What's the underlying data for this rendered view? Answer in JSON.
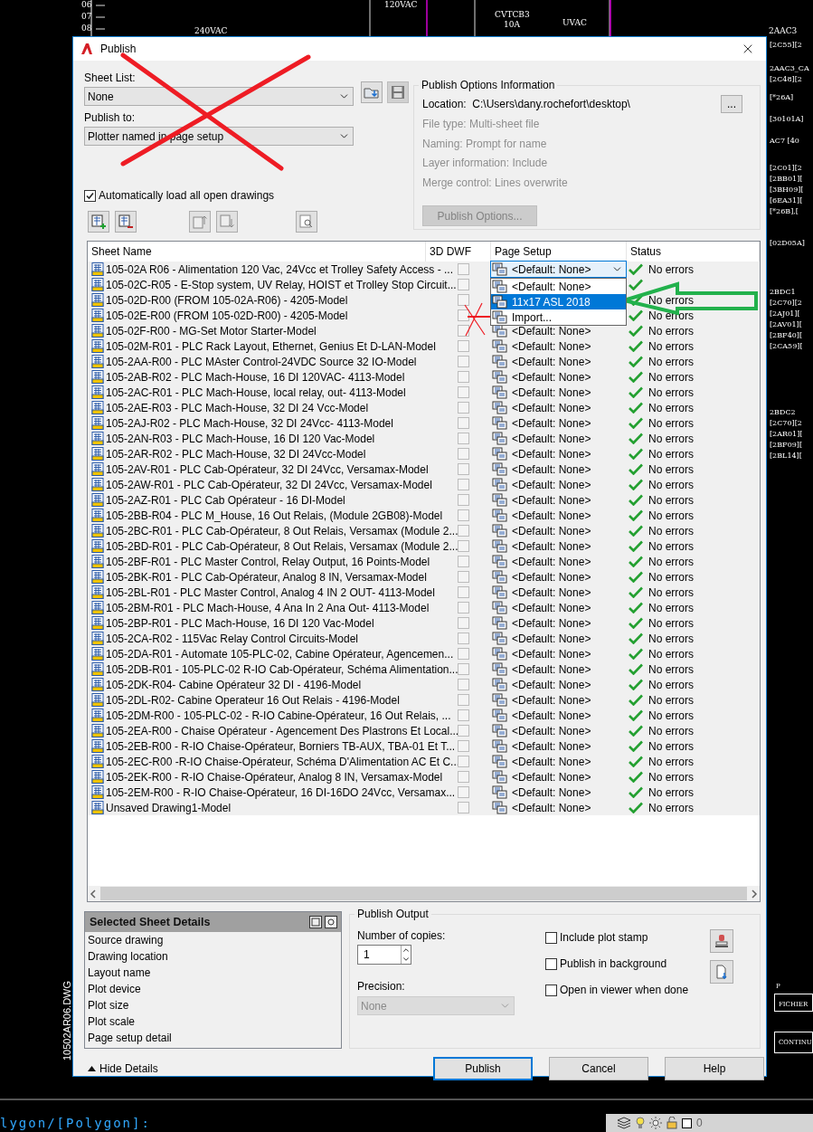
{
  "window": {
    "title": "Publish"
  },
  "sheet_list": {
    "label": "Sheet List:",
    "value": "None"
  },
  "publish_to": {
    "label": "Publish to:",
    "value": "Plotter named in page setup"
  },
  "auto_load": {
    "label": "Automatically load all open drawings",
    "checked": true
  },
  "publish_options_info": {
    "title": "Publish Options Information",
    "location": "Location:  C:\\Users\\dany.rochefort\\desktop\\",
    "browse_button": "...",
    "details": [
      "File type: Multi-sheet file",
      "Naming: Prompt for name",
      "Layer information: Include",
      "Merge control: Lines overwrite"
    ],
    "options_button": {
      "label": "Publish Options...",
      "disabled": true
    }
  },
  "table": {
    "columns": [
      "Sheet Name",
      "3D DWF",
      "Page Setup",
      "Status"
    ],
    "rows": [
      {
        "name": "105-02A R06 - Alimentation 120 Vac, 24Vcc et Trolley Safety Access - ...",
        "dwf_3d": false,
        "page_setup": "<Default: None>",
        "page_setup_options": [
          {
            "label": "<Default: None>",
            "selected": false
          },
          {
            "label": "11x17 ASL 2018",
            "selected": true
          },
          {
            "label": "Import...",
            "selected": false
          }
        ],
        "status": "No errors"
      },
      {
        "name": "105-02C-R05 - E-Stop system, UV Relay, HOIST et Trolley Stop Circuit...",
        "dwf_3d": false
      },
      {
        "name": "105-02D-R00 (FROM 105-02A-R06) - 4205-Model",
        "dwf_3d": false,
        "status": "No errors"
      },
      {
        "name": "105-02E-R00 (FROM 105-02D-R00) - 4205-Model",
        "dwf_3d": false,
        "status": "No errors"
      },
      {
        "name": "105-02F-R00 - MG-Set Motor Starter-Model",
        "dwf_3d": false,
        "page_setup": "<Default: None>",
        "status": "No errors"
      },
      {
        "name": "105-02M-R01 - PLC Rack Layout, Ethernet, Genius Et D-LAN-Model",
        "dwf_3d": false,
        "page_setup": "<Default: None>",
        "status": "No errors"
      },
      {
        "name": "105-2AA-R00 - PLC MAster Control-24VDC Source 32 IO-Model",
        "dwf_3d": false,
        "page_setup": "<Default: None>",
        "status": "No errors"
      },
      {
        "name": "105-2AB-R02 - PLC Mach-House, 16 DI 120VAC- 4113-Model",
        "dwf_3d": false,
        "page_setup": "<Default: None>",
        "status": "No errors"
      },
      {
        "name": "105-2AC-R01 - PLC Mach-House, local relay, out- 4113-Model",
        "dwf_3d": false,
        "page_setup": "<Default: None>",
        "status": "No errors"
      },
      {
        "name": "105-2AE-R03 - PLC Mach-House, 32 DI 24 Vcc-Model",
        "dwf_3d": false,
        "page_setup": "<Default: None>",
        "status": "No errors"
      },
      {
        "name": "105-2AJ-R02 - PLC Mach-House, 32 DI 24Vcc- 4113-Model",
        "dwf_3d": false,
        "page_setup": "<Default: None>",
        "status": "No errors"
      },
      {
        "name": "105-2AN-R03 - PLC Mach-House, 16 DI 120 Vac-Model",
        "dwf_3d": false,
        "page_setup": "<Default: None>",
        "status": "No errors"
      },
      {
        "name": "105-2AR-R02 - PLC Mach-House, 32 DI 24Vcc-Model",
        "dwf_3d": false,
        "page_setup": "<Default: None>",
        "status": "No errors"
      },
      {
        "name": "105-2AV-R01 - PLC Cab-Opérateur, 32 DI 24Vcc, Versamax-Model",
        "dwf_3d": false,
        "page_setup": "<Default: None>",
        "status": "No errors"
      },
      {
        "name": "105-2AW-R01 - PLC Cab-Opérateur, 32 DI 24Vcc, Versamax-Model",
        "dwf_3d": false,
        "page_setup": "<Default: None>",
        "status": "No errors"
      },
      {
        "name": "105-2AZ-R01 - PLC Cab Opérateur - 16 DI-Model",
        "dwf_3d": false,
        "page_setup": "<Default: None>",
        "status": "No errors"
      },
      {
        "name": "105-2BB-R04 - PLC M_House, 16 Out Relais, (Module 2GB08)-Model",
        "dwf_3d": false,
        "page_setup": "<Default: None>",
        "status": "No errors"
      },
      {
        "name": "105-2BC-R01 - PLC Cab-Opérateur, 8 Out Relais, Versamax (Module 2...",
        "dwf_3d": false,
        "page_setup": "<Default: None>",
        "status": "No errors"
      },
      {
        "name": "105-2BD-R01 - PLC Cab-Opérateur, 8 Out Relais, Versamax (Module 2...",
        "dwf_3d": false,
        "page_setup": "<Default: None>",
        "status": "No errors"
      },
      {
        "name": "105-2BF-R01 - PLC Master Control, Relay Output, 16 Points-Model",
        "dwf_3d": false,
        "page_setup": "<Default: None>",
        "status": "No errors"
      },
      {
        "name": "105-2BK-R01 - PLC Cab-Opérateur, Analog 8 IN, Versamax-Model",
        "dwf_3d": false,
        "page_setup": "<Default: None>",
        "status": "No errors"
      },
      {
        "name": "105-2BL-R01 - PLC Master Control, Analog 4 IN  2 OUT- 4113-Model",
        "dwf_3d": false,
        "page_setup": "<Default: None>",
        "status": "No errors"
      },
      {
        "name": "105-2BM-R01 - PLC Mach-House, 4 Ana In 2 Ana Out- 4113-Model",
        "dwf_3d": false,
        "page_setup": "<Default: None>",
        "status": "No errors"
      },
      {
        "name": "105-2BP-R01 - PLC Mach-House, 16 DI 120 Vac-Model",
        "dwf_3d": false,
        "page_setup": "<Default: None>",
        "status": "No errors"
      },
      {
        "name": "105-2CA-R02 - 115Vac Relay Control Circuits-Model",
        "dwf_3d": false,
        "page_setup": "<Default: None>",
        "status": "No errors"
      },
      {
        "name": "105-2DA-R01 - Automate 105-PLC-02, Cabine Opérateur, Agencemen...",
        "dwf_3d": false,
        "page_setup": "<Default: None>",
        "status": "No errors"
      },
      {
        "name": "105-2DB-R01 - 105-PLC-02 R-IO Cab-Opérateur, Schéma Alimentation...",
        "dwf_3d": false,
        "page_setup": "<Default: None>",
        "status": "No errors"
      },
      {
        "name": "105-2DK-R04- Cabine Opérateur 32 DI - 4196-Model",
        "dwf_3d": false,
        "page_setup": "<Default: None>",
        "status": "No errors"
      },
      {
        "name": "105-2DL-R02- Cabine Operateur 16 Out Relais - 4196-Model",
        "dwf_3d": false,
        "page_setup": "<Default: None>",
        "status": "No errors"
      },
      {
        "name": "105-2DM-R00 - 105-PLC-02 - R-IO Cabine-Opérateur, 16 Out Relais, ...",
        "dwf_3d": false,
        "page_setup": "<Default: None>",
        "status": "No errors"
      },
      {
        "name": "105-2EA-R00 - Chaise Opérateur - Agencement Des Plastrons Et Local...",
        "dwf_3d": false,
        "page_setup": "<Default: None>",
        "status": "No errors"
      },
      {
        "name": "105-2EB-R00 - R-IO Chaise-Opérateur, Borniers TB-AUX, TBA-01 Et T...",
        "dwf_3d": false,
        "page_setup": "<Default: None>",
        "status": "No errors"
      },
      {
        "name": "105-2EC-R00 -R-IO Chaise-Opérateur, Schéma D'Alimentation AC Et C...",
        "dwf_3d": false,
        "page_setup": "<Default: None>",
        "status": "No errors"
      },
      {
        "name": "105-2EK-R00 - R-IO Chaise-Opérateur, Analog 8 IN, Versamax-Model",
        "dwf_3d": false,
        "page_setup": "<Default: None>",
        "status": "No errors"
      },
      {
        "name": "105-2EM-R00 - R-IO Chaise-Opérateur, 16 DI-16DO 24Vcc, Versamax...",
        "dwf_3d": false,
        "page_setup": "<Default: None>",
        "status": "No errors"
      },
      {
        "name": "Unsaved Drawing1-Model",
        "dwf_3d": false,
        "page_setup": "<Default: None>",
        "status": "No errors"
      }
    ]
  },
  "details": {
    "title": "Selected Sheet Details",
    "items": [
      "Source drawing",
      "Drawing location",
      "Layout name",
      "Plot device",
      "Plot size",
      "Plot scale",
      "Page setup detail"
    ]
  },
  "publish_output": {
    "title": "Publish Output",
    "copies_label": "Number of copies:",
    "copies": "1",
    "precision_label": "Precision:",
    "precision": {
      "value": "None",
      "disabled": true
    },
    "options": [
      {
        "label": "Include plot stamp",
        "checked": false
      },
      {
        "label": "Publish in background",
        "checked": false
      },
      {
        "label": "Open in viewer when done",
        "checked": false
      }
    ]
  },
  "hide_details": "Hide Details",
  "buttons": [
    "Publish",
    "Cancel",
    "Help"
  ],
  "cad": {
    "labels": [
      "06",
      "07",
      "08",
      "240VAC",
      "120VAC",
      "CVTCB3",
      "10A",
      "UVAC",
      "2AAC3",
      "[2C55][2",
      "2AAC3_CA",
      "[2C48][2",
      "[*26A]",
      "[30101A]",
      "AC7 [40",
      "[2C01][2",
      "[2BB01][",
      "[3BH09][",
      "[6EA31][",
      "[*26B],[",
      "[02D05A]",
      "2BDC1",
      "[2C70][2",
      "[2AJ01][",
      "[2AV01][",
      "[2BF40][",
      "[2CA59][",
      "2BDC2",
      "[2C70][2",
      "[2AR01][",
      "[2BF09][",
      "[2BL14]["
    ],
    "bottom_labels": [
      "P",
      "FICHIER",
      "CONTINU"
    ],
    "file_label": "10502AR06.DWG",
    "command_line": "lygon/[Polygon]:",
    "layer": "0"
  }
}
